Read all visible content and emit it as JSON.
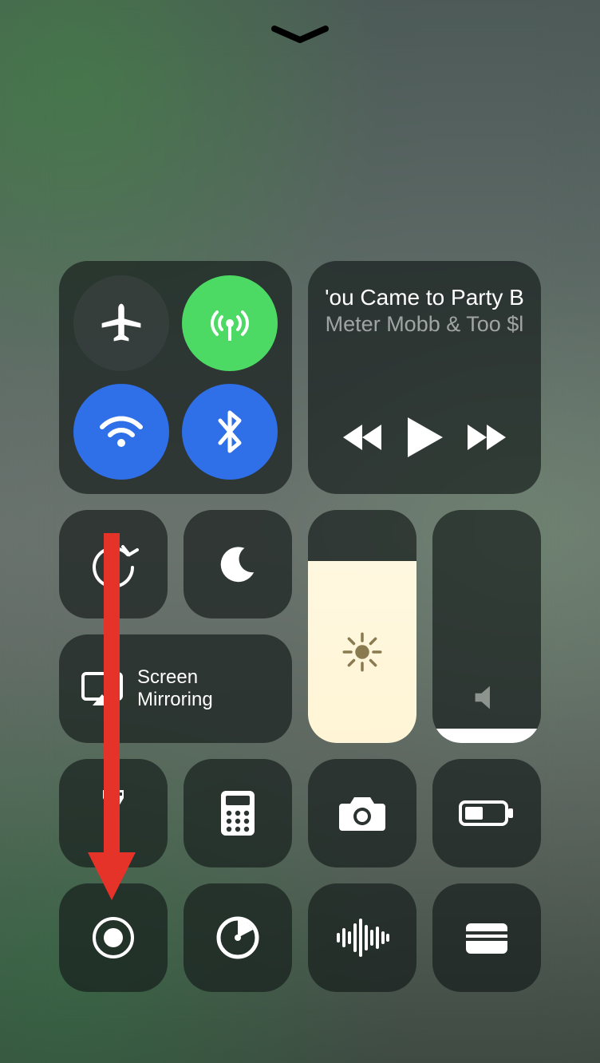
{
  "handle": {
    "name": "collapse-handle"
  },
  "connectivity": {
    "airplane": {
      "name": "airplane-mode-toggle",
      "active": false
    },
    "cellular": {
      "name": "cellular-data-toggle",
      "active": true
    },
    "wifi": {
      "name": "wifi-toggle",
      "active": true
    },
    "bluetooth": {
      "name": "bluetooth-toggle",
      "active": true
    }
  },
  "media": {
    "title": "'ou Came to Party B",
    "artist": "Meter Mobb & Too $l",
    "controls": {
      "prev": "previous-track-button",
      "play": "play-button",
      "next": "next-track-button"
    }
  },
  "toggles": {
    "orientation_lock": {
      "name": "orientation-lock-toggle"
    },
    "dnd": {
      "name": "do-not-disturb-toggle"
    }
  },
  "screen_mirroring": {
    "label": "Screen\nMirroring"
  },
  "sliders": {
    "brightness": {
      "percent": 78
    },
    "volume": {
      "percent": 6
    }
  },
  "shortcuts": [
    {
      "name": "flashlight-button",
      "icon": "flashlight-icon"
    },
    {
      "name": "calculator-button",
      "icon": "calculator-icon"
    },
    {
      "name": "camera-button",
      "icon": "camera-icon"
    },
    {
      "name": "low-power-button",
      "icon": "battery-icon"
    },
    {
      "name": "screen-record-button",
      "icon": "record-icon"
    },
    {
      "name": "timer-button",
      "icon": "timer-icon"
    },
    {
      "name": "voice-memos-button",
      "icon": "waveform-icon"
    },
    {
      "name": "wallet-button",
      "icon": "wallet-icon"
    }
  ],
  "annotation": {
    "target": "screen-record-button",
    "color": "#e5332a"
  }
}
